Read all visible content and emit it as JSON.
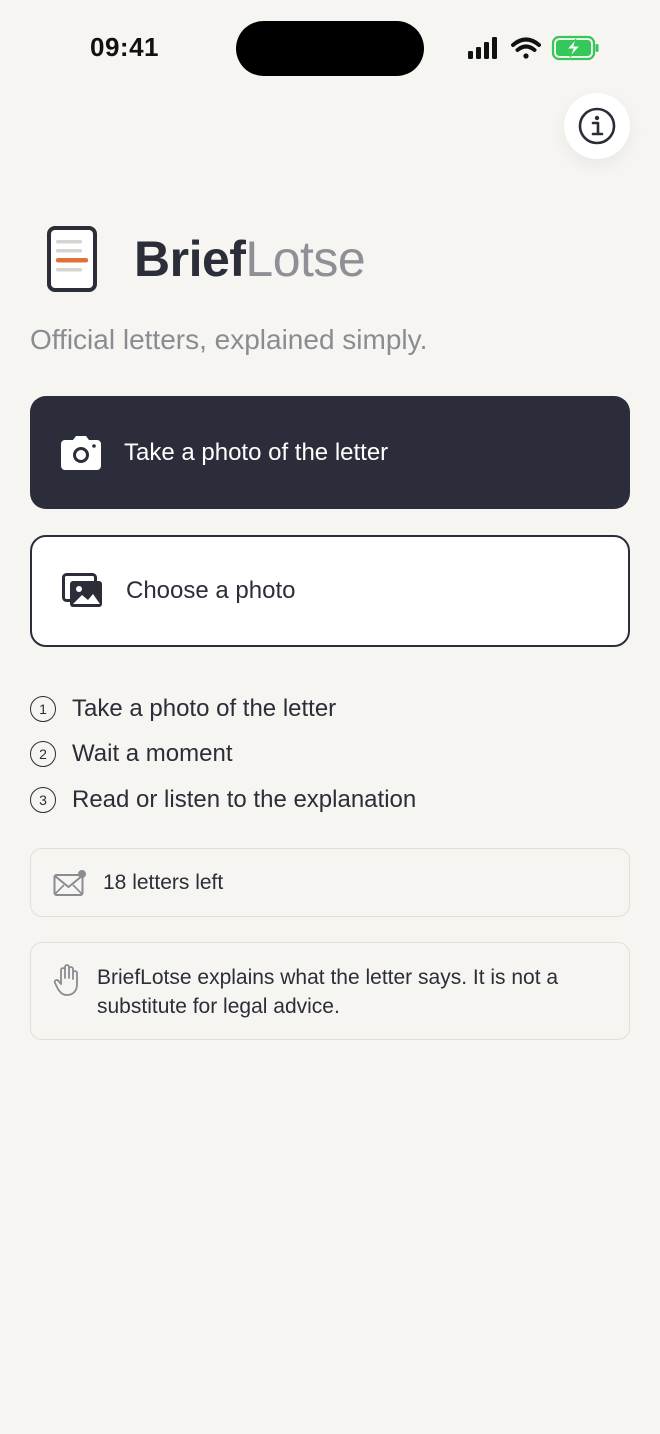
{
  "status_bar": {
    "time": "09:41"
  },
  "header": {
    "info_button_icon": "info-icon"
  },
  "brand": {
    "name_bold": "Brief",
    "name_light": "Lotse",
    "logo_icon": "letter-document-icon",
    "accent_color": "#e0703a"
  },
  "tagline": "Official letters, explained simply.",
  "actions": {
    "take_photo": {
      "label": "Take a photo of the letter",
      "icon": "camera-icon"
    },
    "choose_photo": {
      "label": "Choose a photo",
      "icon": "photo-gallery-icon"
    }
  },
  "steps": [
    {
      "number": "1",
      "label": "Take a photo of the letter"
    },
    {
      "number": "2",
      "label": "Wait a moment"
    },
    {
      "number": "3",
      "label": "Read or listen to the explanation"
    }
  ],
  "quota": {
    "text": "18 letters left",
    "icon": "envelope-icon"
  },
  "disclaimer": {
    "text": "BriefLotse explains what the letter says. It is not a substitute for legal advice.",
    "icon": "hand-icon"
  },
  "colors": {
    "background": "#f7f5f1",
    "primary": "#2b2e3a",
    "muted_text": "#8a8c91",
    "battery": "#34c759"
  }
}
